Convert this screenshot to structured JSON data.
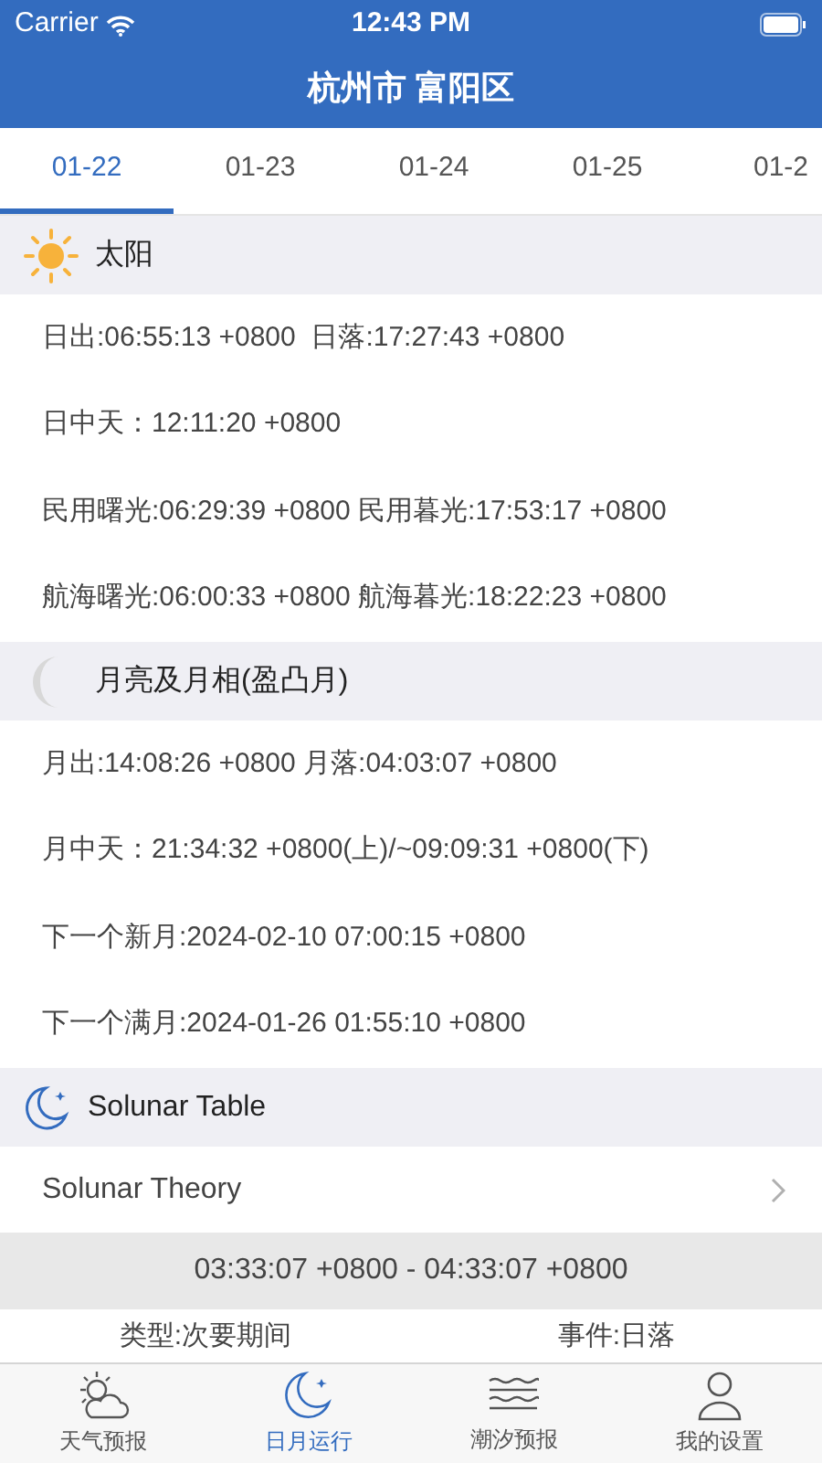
{
  "status_bar": {
    "carrier": "Carrier",
    "time": "12:43 PM"
  },
  "title": "杭州市 富阳区",
  "date_tabs": [
    {
      "label": "01-22",
      "selected": true
    },
    {
      "label": "01-23",
      "selected": false
    },
    {
      "label": "01-24",
      "selected": false
    },
    {
      "label": "01-25",
      "selected": false
    },
    {
      "label": "01-2",
      "selected": false
    }
  ],
  "sections": [
    {
      "title": "太阳",
      "rows": [
        {
          "kind": "text",
          "text": "日出:06:55:13 +0800  日落:17:27:43 +0800"
        },
        {
          "kind": "text",
          "text": "日中天：12:11:20 +0800"
        },
        {
          "kind": "text",
          "text": "民用曙光:06:29:39 +0800 民用暮光:17:53:17 +0800"
        },
        {
          "kind": "text",
          "text": "航海曙光:06:00:33 +0800 航海暮光:18:22:23 +0800"
        }
      ]
    },
    {
      "title": "月亮及月相(盈凸月)",
      "rows": [
        {
          "kind": "text",
          "text": "月出:14:08:26 +0800 月落:04:03:07 +0800"
        },
        {
          "kind": "text",
          "text": "月中天：21:34:32 +0800(上)/~09:09:31 +0800(下)"
        },
        {
          "kind": "text",
          "text": "下一个新月:2024-02-10 07:00:15 +0800"
        },
        {
          "kind": "text",
          "text": "下一个满月:2024-01-26 01:55:10 +0800"
        }
      ]
    },
    {
      "title": "Solunar Table",
      "rows": [
        {
          "kind": "link",
          "text": "Solunar Theory"
        },
        {
          "kind": "period",
          "text": "03:33:07 +0800 - 04:33:07 +0800"
        },
        {
          "kind": "pair",
          "left": "类型:次要期间",
          "right": "事件:日落"
        }
      ]
    }
  ],
  "tab_bar": [
    {
      "label": "天气预报",
      "selected": false
    },
    {
      "label": "日月运行",
      "selected": true
    },
    {
      "label": "潮汐预报",
      "selected": false
    },
    {
      "label": "我的设置",
      "selected": false
    }
  ]
}
